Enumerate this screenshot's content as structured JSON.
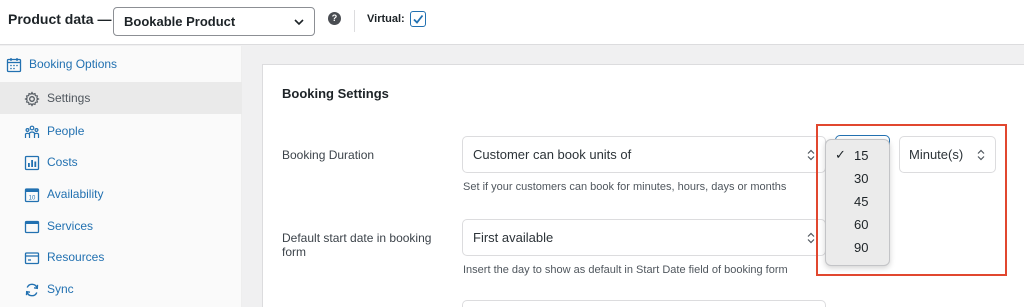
{
  "product_data": {
    "label": "Product data —",
    "type_value": "Bookable Product",
    "help_icon_glyph": "?",
    "virtual_label": "Virtual:",
    "virtual_checked": true
  },
  "sidebar": {
    "items": [
      {
        "label": "Booking Options",
        "icon": "calendar-icon"
      },
      {
        "label": "Settings",
        "icon": "gear-icon"
      },
      {
        "label": "People",
        "icon": "people-icon"
      },
      {
        "label": "Costs",
        "icon": "bar-chart-icon"
      },
      {
        "label": "Availability",
        "icon": "calendar-day-icon"
      },
      {
        "label": "Services",
        "icon": "window-icon"
      },
      {
        "label": "Resources",
        "icon": "card-icon"
      },
      {
        "label": "Sync",
        "icon": "sync-icon"
      }
    ]
  },
  "main": {
    "section_title": "Booking Settings",
    "booking_duration": {
      "label": "Booking Duration",
      "type_value": "Customer can book units of",
      "help": "Set if your customers can book for minutes, hours, days or months",
      "unit_value": "Minute(s)",
      "dropdown_options": [
        "15",
        "30",
        "45",
        "60",
        "90"
      ],
      "selected_option": "15",
      "check_glyph": "✓"
    },
    "default_start": {
      "label": "Default start date in booking form",
      "value": "First available",
      "help": "Insert the day to show as default in Start Date field of booking form"
    }
  },
  "colors": {
    "accent": "#2271b1",
    "highlight": "#e1472f"
  }
}
